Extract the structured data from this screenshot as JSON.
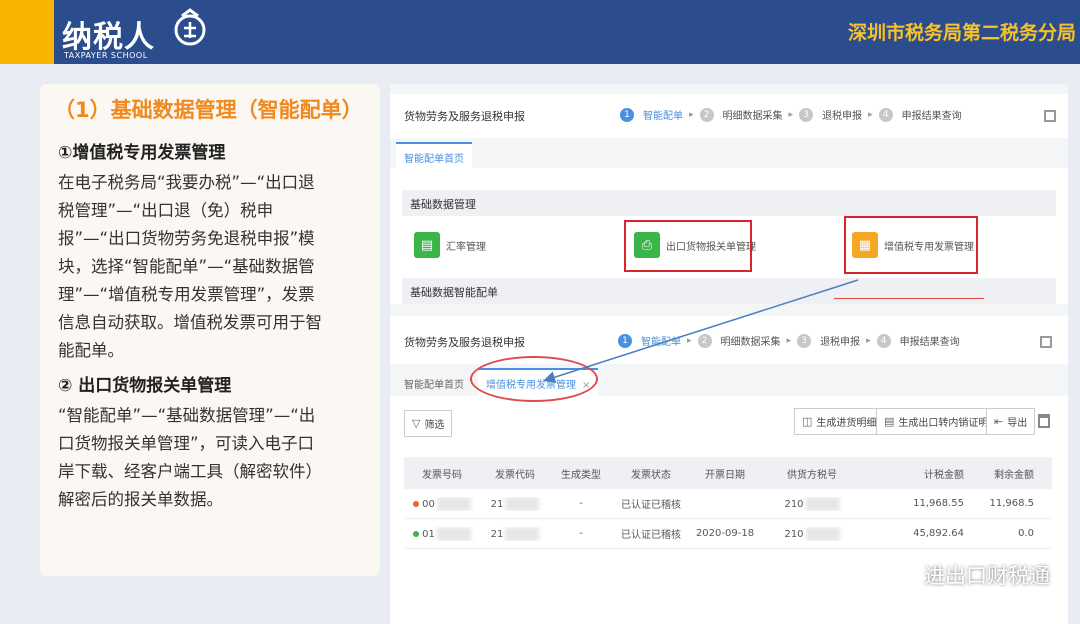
{
  "header": {
    "logo_text": "纳税人",
    "logo_subtext": "TAXPAYER SCHOOL",
    "bureau": "深圳市税务局第二税务分局",
    "colors": {
      "bar": "#2b4d8d",
      "accent": "#f7b500",
      "bureau_text": "#f6c12a"
    }
  },
  "left_panel": {
    "title": "（1）基础数据管理（智能配单）",
    "item1_heading": "①增值税专用发票管理",
    "item1_body": "在电子税务局“我要办税”—“出口退税管理”—“出口退（免）税申报”—“出口货物劳务免退税申报”模块，选择“智能配单”—“基础数据管理”—“增值税专用发票管理”，发票信息自动获取。增值税发票可用于智能配单。",
    "item2_heading": "② 出口货物报关单管理",
    "item2_body": "“智能配单”—“基础数据管理”—“出口货物报关单管理”，可读入电子口岸下载、经客户端工具（解密软件）解密后的报关单数据。"
  },
  "screen_top": {
    "nav_title": "货物劳务及服务退税申报",
    "steps": [
      {
        "num": "1",
        "label": "智能配单",
        "active": true
      },
      {
        "num": "2",
        "label": "明细数据采集",
        "active": false
      },
      {
        "num": "3",
        "label": "退税申报",
        "active": false
      },
      {
        "num": "4",
        "label": "申报结果查询",
        "active": false
      }
    ],
    "tab": "智能配单首页",
    "group1": "基础数据管理",
    "tiles": [
      "汇率管理",
      "出口货物报关单管理",
      "增值税专用发票管理"
    ],
    "group2": "基础数据智能配单"
  },
  "screen_bottom": {
    "nav_title": "货物劳务及服务退税申报",
    "steps": [
      {
        "num": "1",
        "label": "智能配单",
        "active": true
      },
      {
        "num": "2",
        "label": "明细数据采集",
        "active": false
      },
      {
        "num": "3",
        "label": "退税申报",
        "active": false
      },
      {
        "num": "4",
        "label": "申报结果查询",
        "active": false
      }
    ],
    "tab_home": "智能配单首页",
    "tab_active": "增值税专用发票管理",
    "filter_label": "筛选",
    "buttons": [
      "生成进货明细",
      "生成出口转内销证明",
      "导出"
    ],
    "columns": [
      "发票号码",
      "发票代码",
      "生成类型",
      "发票状态",
      "开票日期",
      "供货方税号",
      "计税金额",
      "剩余金额"
    ],
    "rows": [
      {
        "no": "00",
        "code": "21",
        "type": "-",
        "status": "已认证已稽核",
        "date": "",
        "seller": "210",
        "amount": "11,968.55",
        "remain": "11,968.5",
        "dot": "#e8622c"
      },
      {
        "no": "01",
        "code": "21",
        "type": "-",
        "status": "已认证已稽核",
        "date": "2020-09-18",
        "seller": "210",
        "amount": "45,892.64",
        "remain": "0.0",
        "dot": "#39b54a"
      }
    ]
  },
  "watermark": "进出口财税通"
}
